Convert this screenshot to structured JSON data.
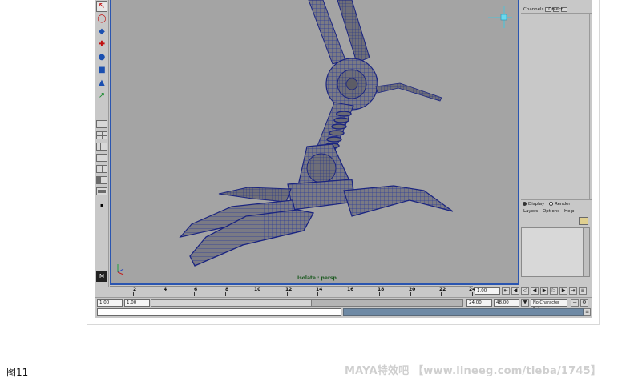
{
  "channel_box": {
    "menu": [
      "Channels",
      "Object"
    ]
  },
  "layer_editor": {
    "mode_display": "Display",
    "mode_render": "Render",
    "menu": [
      "Layers",
      "Options",
      "Help"
    ]
  },
  "viewport": {
    "label": "Isolate : persp"
  },
  "time_slider": {
    "ticks": [
      "2",
      "4",
      "6",
      "8",
      "10",
      "12",
      "14",
      "16",
      "18",
      "20",
      "22",
      "24"
    ],
    "current_frame": "1.00"
  },
  "range_slider": {
    "start_time": "1.00",
    "playback_start": "1.00",
    "playback_end": "24.00",
    "end_time": "48.00",
    "character_set": "No Character Set"
  },
  "caption": "图11",
  "watermark": "MAYA特效吧 【www.lineeg.com/tieba/1745】",
  "colors": {
    "viewport_bg": "#a4a4a4",
    "active_border": "#2a55b0",
    "ui_gray": "#c8c8c8"
  }
}
